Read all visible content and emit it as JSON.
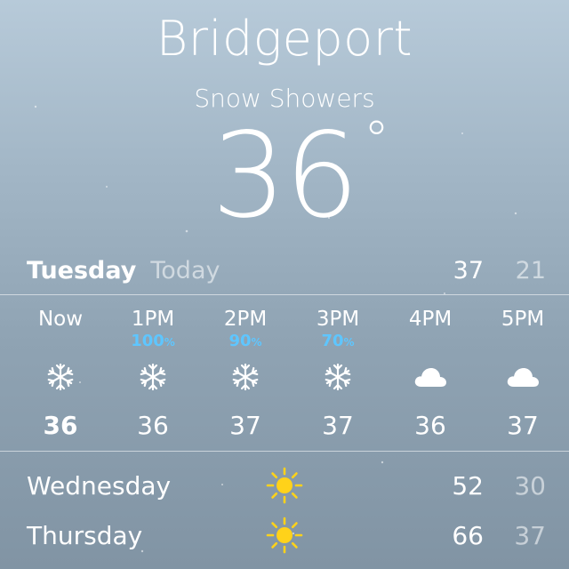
{
  "location": {
    "city": "Bridgeport",
    "condition": "Snow Showers",
    "temperature": "36",
    "degree_symbol": "°"
  },
  "today": {
    "day": "Tuesday",
    "label": "Today",
    "high": "37",
    "low": "21"
  },
  "hourly": [
    {
      "time": "Now",
      "precip": "",
      "icon": "snowflake-icon",
      "temp": "36"
    },
    {
      "time": "1PM",
      "precip": "100",
      "icon": "snowflake-icon",
      "temp": "36"
    },
    {
      "time": "2PM",
      "precip": "90",
      "icon": "snowflake-icon",
      "temp": "37"
    },
    {
      "time": "3PM",
      "precip": "70",
      "icon": "snowflake-icon",
      "temp": "37"
    },
    {
      "time": "4PM",
      "precip": "",
      "icon": "cloud-icon",
      "temp": "36"
    },
    {
      "time": "5PM",
      "precip": "",
      "icon": "cloud-icon",
      "temp": "37"
    }
  ],
  "percent_symbol": "%",
  "daily": [
    {
      "day": "Wednesday",
      "icon": "sun-icon",
      "high": "52",
      "low": "30"
    },
    {
      "day": "Thursday",
      "icon": "sun-icon",
      "high": "66",
      "low": "37"
    }
  ],
  "colors": {
    "precip_text": "#5ec6ff",
    "sun": "#ffd21a"
  }
}
